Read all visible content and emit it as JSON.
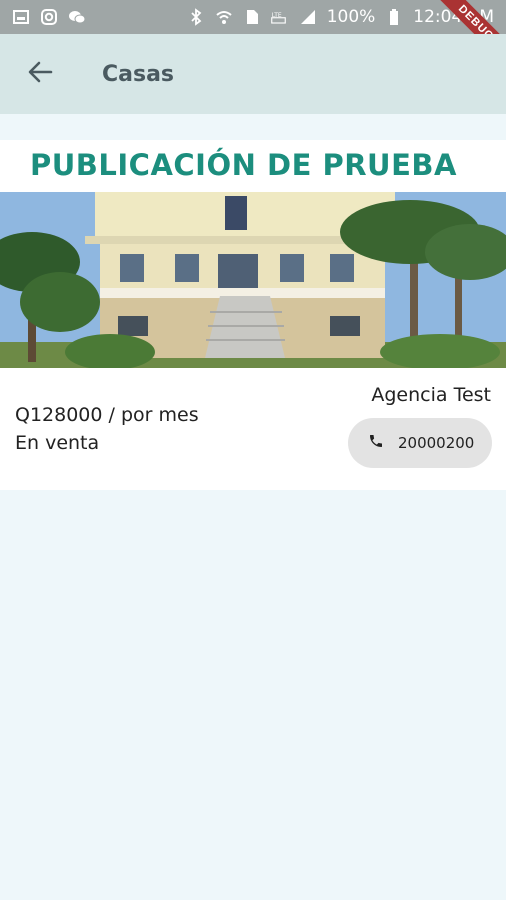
{
  "status_bar": {
    "battery_percent": "100%",
    "time": "12:04 AM",
    "network_label": "LTE",
    "debug_label": "DEBUG"
  },
  "app_bar": {
    "title": "Casas"
  },
  "listing": {
    "title": "PUBLICACIÓN DE PRUEBA",
    "price": "Q128000 / por mes",
    "status": "En venta",
    "agency": "Agencia Test",
    "phone": "20000200"
  },
  "colors": {
    "accent": "#1c8e7e",
    "app_bar": "#d6e6e6",
    "background": "#eef7fa"
  }
}
